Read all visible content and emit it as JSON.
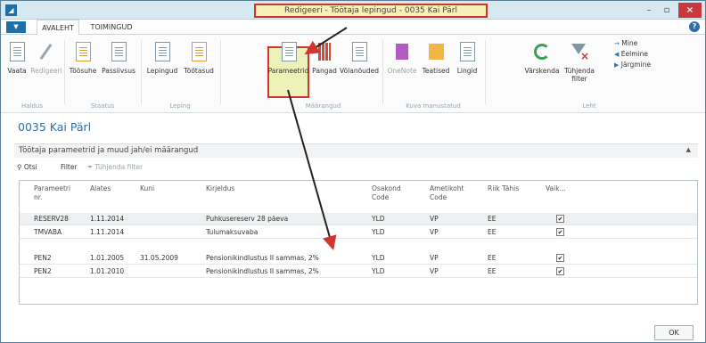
{
  "window": {
    "title": "Redigeeri - Töötaja lepingud - 0035  Kai Pärl"
  },
  "tabs": [
    "AVALEHT",
    "TOIMINGUD"
  ],
  "ribbon": {
    "groups": [
      {
        "name": "Haldus",
        "buttons": [
          "Vaata",
          "Redigeeri"
        ]
      },
      {
        "name": "Staatus",
        "buttons": [
          "Töösuhe",
          "Passiivsus"
        ]
      },
      {
        "name": "Leping",
        "buttons": [
          "Lepingud",
          "Töötasud"
        ]
      },
      {
        "name": "Määrangud",
        "buttons": [
          "Parameetrid",
          "Pangad",
          "Võlanõuded"
        ]
      },
      {
        "name": "Kuva manustatud",
        "buttons": [
          "OneNote",
          "Teatised",
          "Lingid"
        ]
      },
      {
        "name": "Leht",
        "buttons": [
          "Värskenda",
          "Tühjenda",
          "filter"
        ]
      }
    ],
    "nav": [
      "Mine",
      "Eelmine",
      "Järgmine"
    ]
  },
  "page": {
    "title": "0035  Kai Pärl"
  },
  "fasttab": {
    "title": "Töötaja parameetrid ja muud jah/ei määrangud"
  },
  "toolbar": {
    "find": "Otsi",
    "filter": "Filter",
    "clear_filter": "Tühjenda filter"
  },
  "table": {
    "headers": [
      "Parameetri",
      "nr.",
      "Alates",
      "Kuni",
      "Kirjeldus",
      "Osakond",
      "Code",
      "Ametikoht",
      "Code",
      "Riik Tähis",
      "Vaik..."
    ],
    "rows": [
      {
        "param": "RESERV28",
        "from": "1.11.2014",
        "to": "",
        "desc": "Puhkusereserv 28 päeva",
        "dept": "YLD",
        "pos": "VP",
        "country": "EE",
        "default": "✔"
      },
      {
        "param": "TMVABA",
        "from": "1.11.2014",
        "to": "",
        "desc": "Tulumaksuvaba",
        "dept": "YLD",
        "pos": "VP",
        "country": "EE",
        "default": "✔"
      },
      {
        "param": "PEN2",
        "from": "1.01.2005",
        "to": "31.05.2009",
        "desc": "Pensionikindlustus II sammas, 2%",
        "dept": "YLD",
        "pos": "VP",
        "country": "EE",
        "default": "✔"
      },
      {
        "param": "PEN2",
        "from": "1.01.2010",
        "to": "",
        "desc": "Pensionikindlustus II sammas, 2%",
        "dept": "YLD",
        "pos": "VP",
        "country": "EE",
        "default": "✔"
      }
    ]
  },
  "buttons": {
    "ok": "OK"
  },
  "colors": {
    "accent": "#2d6fa8",
    "highlight_border": "#d1352d",
    "highlight_fill": "#ecf1b7"
  }
}
